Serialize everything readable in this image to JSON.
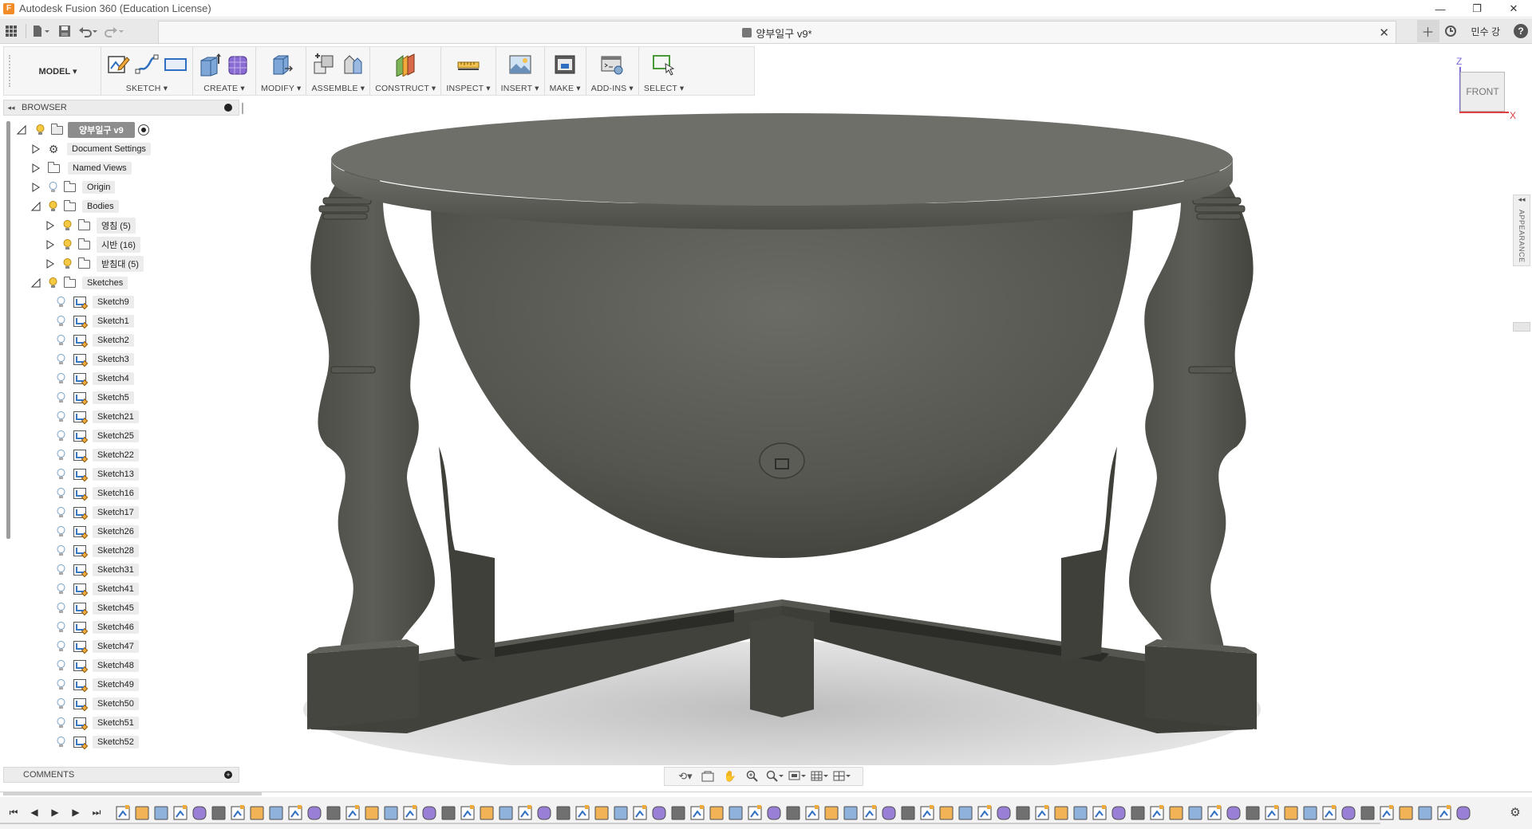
{
  "app": {
    "title": "Autodesk Fusion 360 (Education License)",
    "logo_letter": "F"
  },
  "quickaccess": {
    "grid_icon": "app-grid-icon",
    "file_icon": "file-icon",
    "save_icon": "save-icon",
    "undo_icon": "undo-icon",
    "redo_icon": "redo-icon"
  },
  "document": {
    "tab_title": "양부일구 v9*",
    "close": "✕"
  },
  "user": {
    "name": "민수 강"
  },
  "toolbar": {
    "workspace": "MODEL ▾",
    "groups": [
      {
        "label": "SKETCH ▾"
      },
      {
        "label": "CREATE ▾"
      },
      {
        "label": "MODIFY ▾"
      },
      {
        "label": "ASSEMBLE ▾"
      },
      {
        "label": "CONSTRUCT ▾"
      },
      {
        "label": "INSPECT ▾"
      },
      {
        "label": "INSERT ▾"
      },
      {
        "label": "MAKE ▾"
      },
      {
        "label": "ADD-INS ▾"
      },
      {
        "label": "SELECT ▾"
      }
    ]
  },
  "browser": {
    "title": "BROWSER",
    "collapse": "◂◂",
    "root": "양부일구 v9",
    "document_settings": "Document Settings",
    "named_views": "Named Views",
    "origin": "Origin",
    "bodies": "Bodies",
    "body_folders": [
      {
        "label": "영침 (5)"
      },
      {
        "label": "시반 (16)"
      },
      {
        "label": "받침대 (5)"
      }
    ],
    "sketches_label": "Sketches",
    "sketches": [
      {
        "label": "Sketch9"
      },
      {
        "label": "Sketch1"
      },
      {
        "label": "Sketch2"
      },
      {
        "label": "Sketch3"
      },
      {
        "label": "Sketch4"
      },
      {
        "label": "Sketch5"
      },
      {
        "label": "Sketch21"
      },
      {
        "label": "Sketch25"
      },
      {
        "label": "Sketch22"
      },
      {
        "label": "Sketch13"
      },
      {
        "label": "Sketch16"
      },
      {
        "label": "Sketch17"
      },
      {
        "label": "Sketch26"
      },
      {
        "label": "Sketch28"
      },
      {
        "label": "Sketch31"
      },
      {
        "label": "Sketch41"
      },
      {
        "label": "Sketch45"
      },
      {
        "label": "Sketch46"
      },
      {
        "label": "Sketch47"
      },
      {
        "label": "Sketch48"
      },
      {
        "label": "Sketch49"
      },
      {
        "label": "Sketch50"
      },
      {
        "label": "Sketch51"
      },
      {
        "label": "Sketch52"
      }
    ]
  },
  "comments": {
    "title": "COMMENTS",
    "add": "+"
  },
  "viewcube": {
    "face": "FRONT",
    "z": "Z",
    "x": "X"
  },
  "side_panel": {
    "appearance": "APPEARANCE",
    "collapse": "◂◂"
  },
  "colors": {
    "model": "#4a4b45",
    "model_light": "#5e5f58",
    "shadow": "#d6d6d6",
    "accent_blue": "#2f6fc0"
  },
  "timeline": {
    "feature_count": 71
  }
}
